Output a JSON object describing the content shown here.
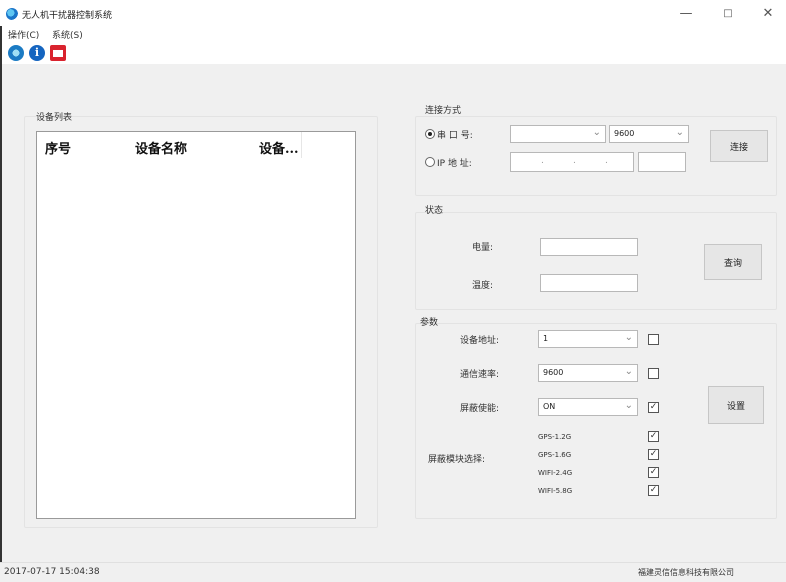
{
  "window": {
    "title": "无人机干扰器控制系统",
    "controls": [
      "—",
      "□",
      "✕"
    ]
  },
  "menu": {
    "items": [
      "操作(C)",
      "系统(S)"
    ]
  },
  "toolbar": {
    "icons": [
      "refresh-icon",
      "info-icon",
      "exit-icon"
    ]
  },
  "device_list": {
    "title": "设备列表",
    "columns": [
      "序号",
      "设备名称",
      "设备..."
    ]
  },
  "connection": {
    "title": "连接方式",
    "serial_label": "串 口 号:",
    "serial_port_value": "",
    "baud_value": "9600",
    "ip_label": "IP 地 址:",
    "ip_dots": [
      ".",
      ".",
      "."
    ],
    "connect_button": "连接"
  },
  "status": {
    "title": "状态",
    "battery_label": "电量:",
    "temp_label": "温度:",
    "query_button": "查询"
  },
  "params": {
    "title": "参数",
    "device_address_label": "设备地址:",
    "device_address_value": "1",
    "baud_label": "通信速率:",
    "baud_value": "9600",
    "shield_enable_label": "屏蔽使能:",
    "shield_enable_value": "ON",
    "module_label": "屏蔽模块选择:",
    "modules": [
      "GPS-1.2G",
      "GPS-1.6G",
      "WIFI-2.4G",
      "WIFI-5.8G"
    ],
    "set_button": "设置"
  },
  "statusbar": {
    "datetime": "2017-07-17  15:04:38",
    "company": "福建灵信信息科技有限公司"
  }
}
